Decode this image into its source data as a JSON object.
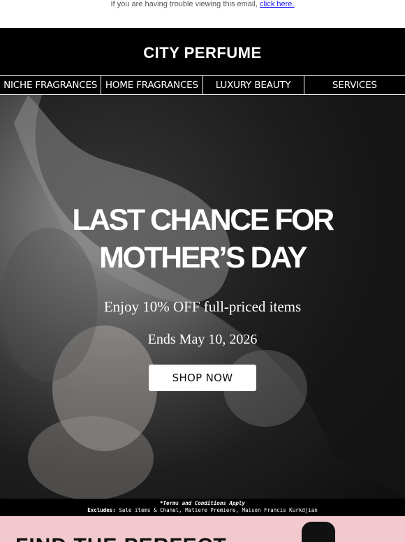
{
  "preheader": {
    "text": "If you are having trouble viewing this email,",
    "link": "click here."
  },
  "brand": {
    "name": "CITY PERFUME"
  },
  "nav": {
    "items": [
      "NICHE FRAGRANCES",
      "HOME FRAGRANCES",
      "LUXURY BEAUTY",
      "SERVICES"
    ]
  },
  "hero": {
    "title_line1": "LAST CHANCE FOR",
    "title_line2": "MOTHER’S DAY",
    "subtitle": "Enjoy 10% OFF full-priced items",
    "ends": "Ends May 10, 2026",
    "cta": "SHOP NOW"
  },
  "terms": {
    "line1": "*Terms and Conditions Apply",
    "excludes_label": "Excludes:",
    "excludes_text": " Sale items & Chanel, Matiere Premiere, Maison Francis Kurkdjian"
  },
  "promo": {
    "title": "FIND THE PERFECT"
  },
  "colors": {
    "black": "#000000",
    "pink": "#f1c9cf",
    "link": "#1a1aff"
  }
}
